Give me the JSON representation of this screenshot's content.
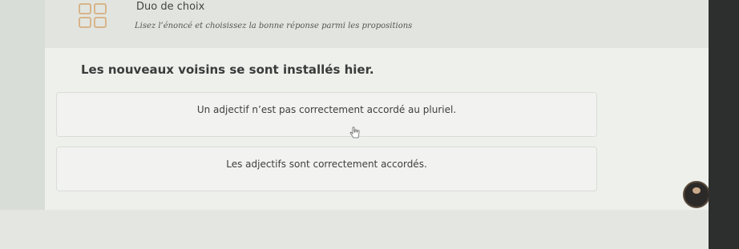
{
  "header": {
    "title": "Duo de choix",
    "subtitle": "Lisez l’énoncé et choisissez la bonne réponse parmi les propositions"
  },
  "question": {
    "text": "Les nouveaux voisins se sont installés hier."
  },
  "options": [
    {
      "label": "Un adjectif n’est pas correctement accordé au pluriel."
    },
    {
      "label": "Les adjectifs sont correctement accordés."
    }
  ],
  "icons": {
    "exercise_type": "grid-icon",
    "pointer": "hand-cursor-icon",
    "assistant": "avatar-icon"
  },
  "colors": {
    "icon_accent": "#d7b48b"
  }
}
